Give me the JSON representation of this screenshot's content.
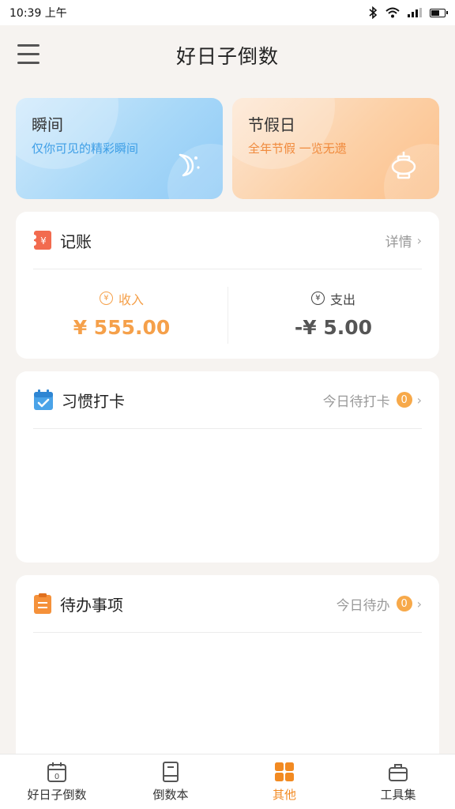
{
  "status_bar": {
    "time": "10:39 上午"
  },
  "app_bar": {
    "title": "好日子倒数"
  },
  "promos": [
    {
      "title": "瞬间",
      "subtitle": "仅你可见的精彩瞬间",
      "icon": "moon-icon"
    },
    {
      "title": "节假日",
      "subtitle": "全年节假 一览无遗",
      "icon": "lantern-icon"
    }
  ],
  "accounting": {
    "title": "记账",
    "details_label": "详情",
    "income_label": "收入",
    "income_value": "¥ 555.00",
    "expense_label": "支出",
    "expense_value": "-¥ 5.00"
  },
  "habits": {
    "title": "习惯打卡",
    "today_label": "今日待打卡",
    "count": "0"
  },
  "todos": {
    "title": "待办事项",
    "today_label": "今日待办",
    "count": "0"
  },
  "bottom_nav": [
    {
      "label": "好日子倒数",
      "icon": "calendar-icon"
    },
    {
      "label": "倒数本",
      "icon": "book-icon"
    },
    {
      "label": "其他",
      "icon": "grid-icon",
      "active": true
    },
    {
      "label": "工具集",
      "icon": "toolbox-icon"
    }
  ],
  "colors": {
    "accent": "#f28a22",
    "income": "#f5a04a",
    "blue_text": "#3d9ee6",
    "orange_text": "#f08a3c"
  }
}
